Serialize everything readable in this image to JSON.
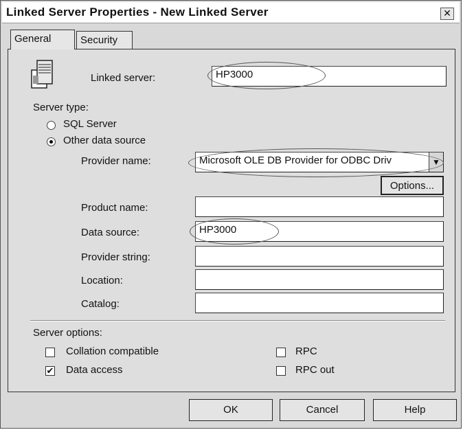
{
  "window": {
    "title": "Linked Server Properties - New Linked Server",
    "close_label": "✕"
  },
  "tabs": [
    {
      "label": "General"
    },
    {
      "label": "Security"
    }
  ],
  "linked_server": {
    "label": "Linked server:",
    "value": "HP3000"
  },
  "server_type": {
    "heading": "Server type:",
    "sql_server_label": "SQL Server",
    "other_source_label": "Other data source",
    "selected": "Other data source"
  },
  "provider": {
    "label": "Provider name:",
    "value": "Microsoft OLE DB Provider for ODBC Driv",
    "options_button": "Options..."
  },
  "fields": {
    "product_name": {
      "label": "Product name:",
      "value": ""
    },
    "data_source": {
      "label": "Data source:",
      "value": "HP3000"
    },
    "provider_string": {
      "label": "Provider string:",
      "value": ""
    },
    "location": {
      "label": "Location:",
      "value": ""
    },
    "catalog": {
      "label": "Catalog:",
      "value": ""
    }
  },
  "server_options": {
    "heading": "Server options:",
    "collation_compatible": {
      "label": "Collation compatible",
      "checked": false
    },
    "data_access": {
      "label": "Data access",
      "checked": true
    },
    "rpc": {
      "label": "RPC",
      "checked": false
    },
    "rpc_out": {
      "label": "RPC out",
      "checked": false
    }
  },
  "buttons": {
    "ok": "OK",
    "cancel": "Cancel",
    "help": "Help"
  }
}
